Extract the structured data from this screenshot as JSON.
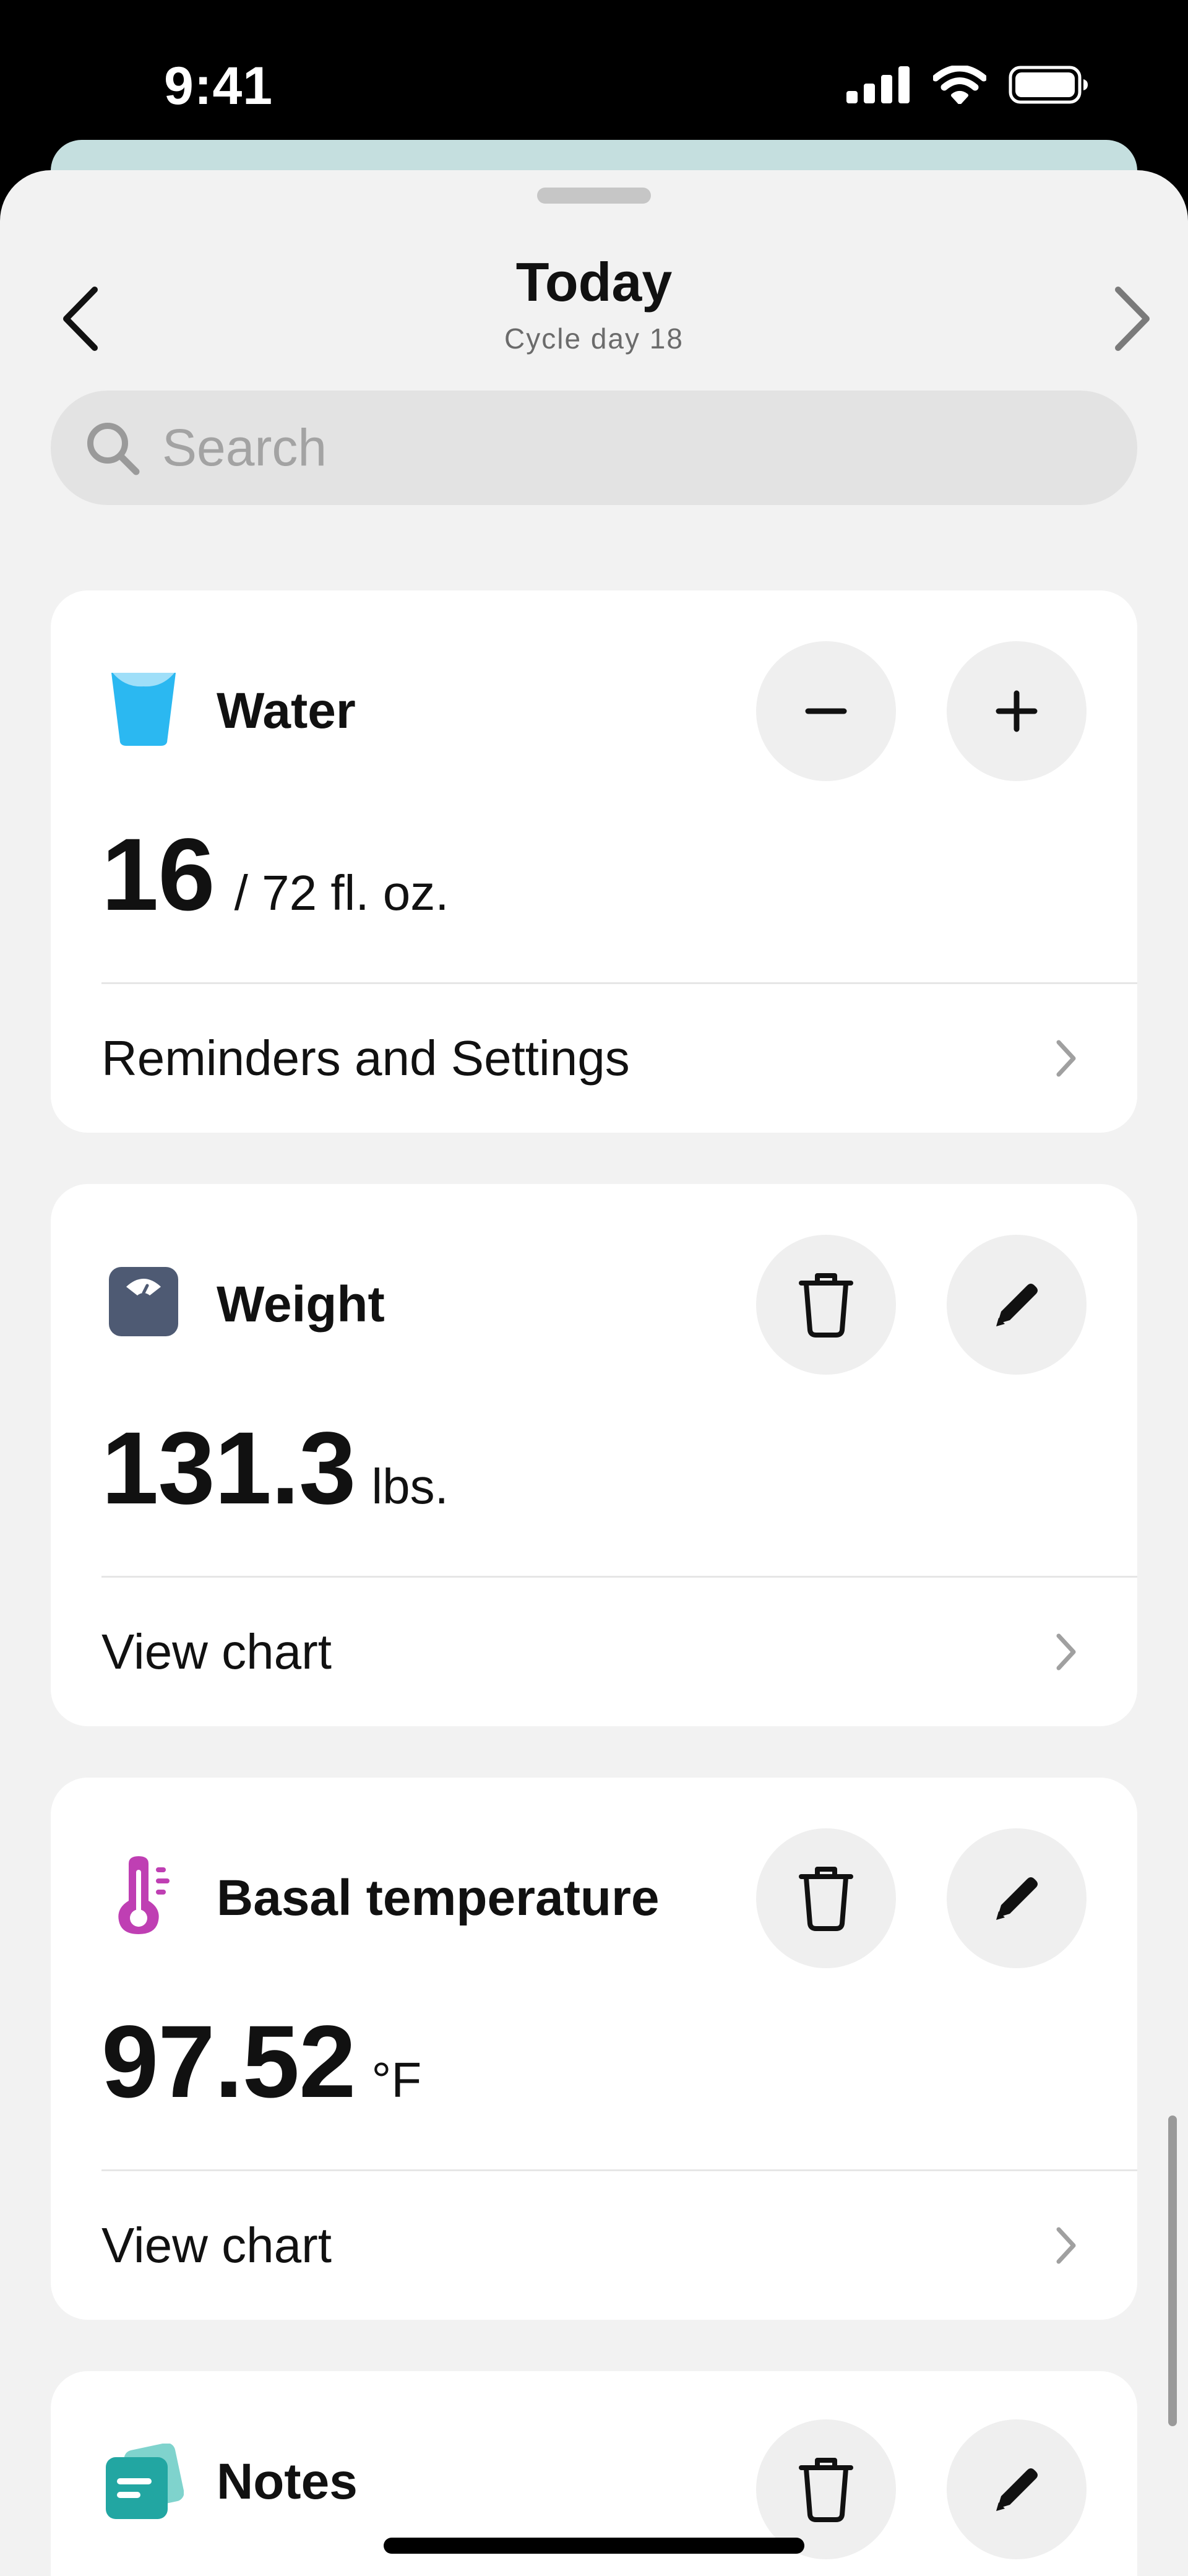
{
  "status_bar": {
    "time": "9:41",
    "icons": [
      "cellular-signal-icon",
      "wifi-icon",
      "battery-icon"
    ]
  },
  "nav": {
    "title": "Today",
    "subtitle": "Cycle day 18"
  },
  "search": {
    "placeholder": "Search"
  },
  "cards": {
    "water": {
      "title": "Water",
      "value": "16",
      "unit": "/ 72 fl. oz.",
      "link": "Reminders and Settings"
    },
    "weight": {
      "title": "Weight",
      "value": "131.3",
      "unit": "lbs.",
      "link": "View chart"
    },
    "basal": {
      "title": "Basal temperature",
      "value": "97.52",
      "unit": "°F",
      "link": "View chart"
    },
    "notes": {
      "title": "Notes"
    }
  },
  "colors": {
    "water_icon": "#2bb8f1",
    "weight_icon": "#4e5a73",
    "basal_icon": "#bf3fb3",
    "notes_icon": "#22a6a2",
    "sheet_background": "#f2f2f2",
    "peek_sheet": "#c5dfdf"
  }
}
